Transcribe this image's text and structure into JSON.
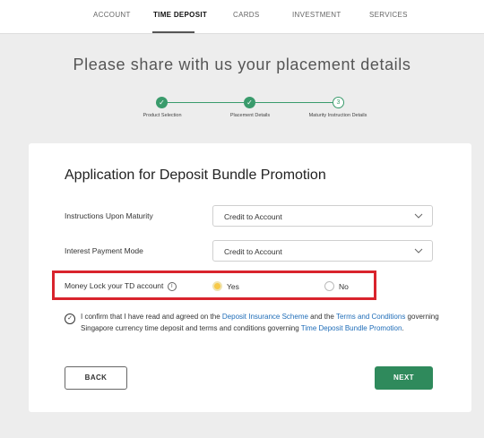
{
  "nav": {
    "items": [
      {
        "label": "ACCOUNT"
      },
      {
        "label": "TIME DEPOSIT"
      },
      {
        "label": "CARDS"
      },
      {
        "label": "INVESTMENT"
      },
      {
        "label": "SERVICES"
      }
    ],
    "active_index": 1
  },
  "headline": "Please share with us your placement details",
  "stepper": {
    "steps": [
      {
        "label": "Product Selection",
        "status": "done"
      },
      {
        "label": "Placement Details",
        "status": "done"
      },
      {
        "label": "Maturity Instruction Details",
        "status": "current",
        "number": "3"
      }
    ],
    "accent": "#3a9b6c"
  },
  "form": {
    "title": "Application for Deposit Bundle Promotion",
    "maturity": {
      "label": "Instructions Upon Maturity",
      "value": "Credit to Account"
    },
    "interest": {
      "label": "Interest Payment Mode",
      "value": "Credit to Account"
    },
    "money_lock": {
      "label": "Money Lock your TD account",
      "info_glyph": "i",
      "options": [
        {
          "label": "Yes",
          "selected": true
        },
        {
          "label": "No",
          "selected": false
        }
      ]
    },
    "confirm": {
      "text_1": "I confirm that I have read and agreed on the ",
      "link_1": "Deposit Insurance Scheme",
      "text_2": " and the ",
      "link_2": "Terms and Conditions",
      "text_3": " governing Singapore currency time deposit and terms and conditions governing ",
      "link_3": "Time Deposit Bundle Promotion",
      "text_4": "."
    }
  },
  "buttons": {
    "back": "BACK",
    "next": "NEXT"
  },
  "colors": {
    "primary": "#2f8a5c",
    "highlight": "#d9232d",
    "link": "#1f6db8",
    "radio_selected": "#f7c948"
  }
}
